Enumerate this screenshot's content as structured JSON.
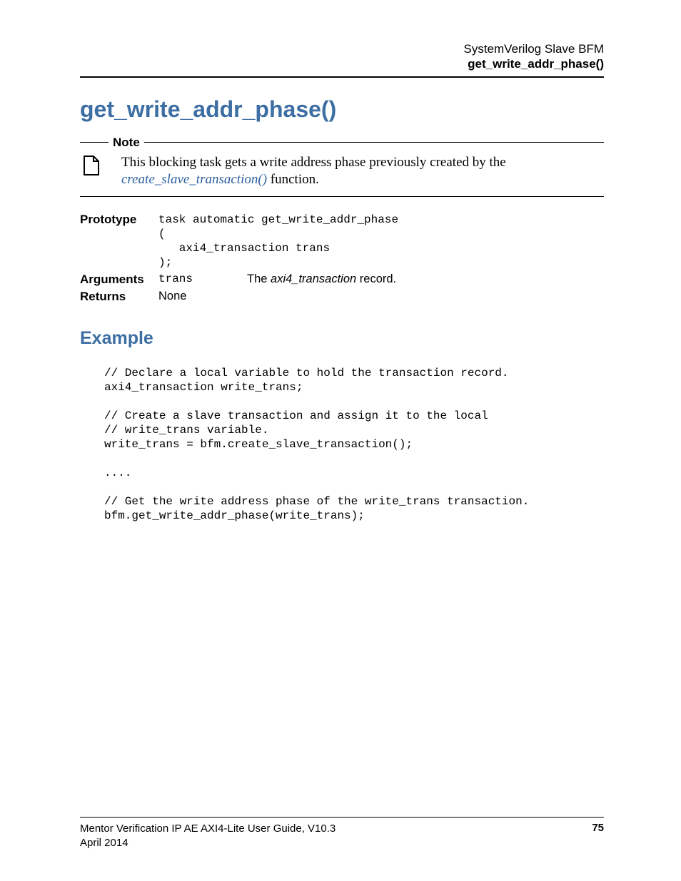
{
  "header": {
    "line1": "SystemVerilog Slave BFM",
    "line2": "get_write_addr_phase()"
  },
  "title": "get_write_addr_phase()",
  "note": {
    "label": "Note",
    "text_before_link": "This blocking task gets a write address phase previously created by the ",
    "link_text": "create_slave_transaction()",
    "text_after_link": " function."
  },
  "defs": {
    "prototype": {
      "label": "Prototype",
      "code": "task automatic get_write_addr_phase\n(\n   axi4_transaction trans\n);"
    },
    "arguments": {
      "label": "Arguments",
      "arg_name": "trans",
      "desc_prefix": "The ",
      "desc_ital": "axi4_transaction",
      "desc_suffix": " record."
    },
    "returns": {
      "label": "Returns",
      "value": "None"
    }
  },
  "example": {
    "heading": "Example",
    "code": "// Declare a local variable to hold the transaction record.\naxi4_transaction write_trans;\n\n// Create a slave transaction and assign it to the local\n// write_trans variable.\nwrite_trans = bfm.create_slave_transaction();\n\n....\n\n// Get the write address phase of the write_trans transaction.\nbfm.get_write_addr_phase(write_trans);"
  },
  "footer": {
    "left_line1": "Mentor Verification IP AE AXI4-Lite User Guide, V10.3",
    "left_line2": "April 2014",
    "page": "75"
  }
}
